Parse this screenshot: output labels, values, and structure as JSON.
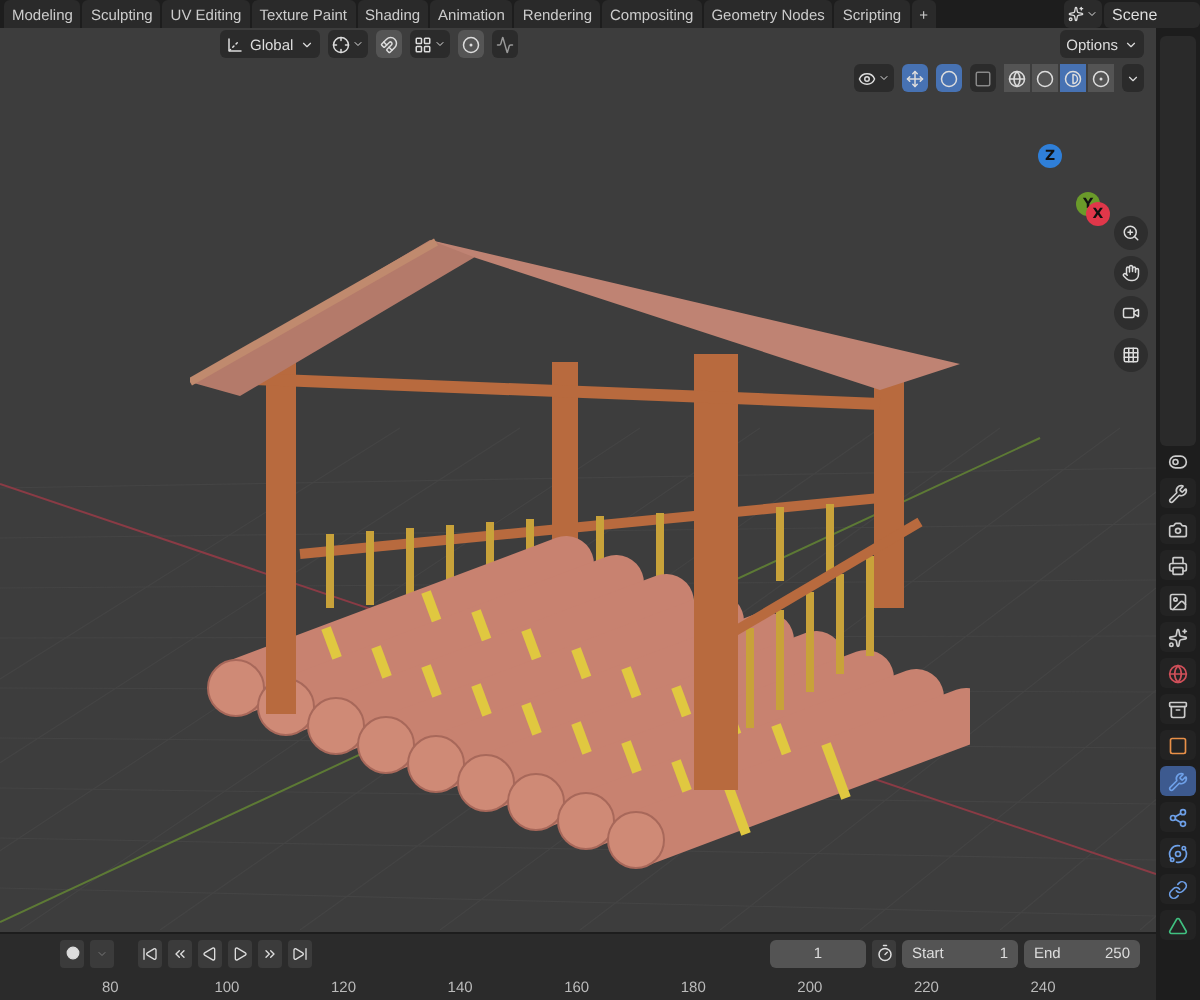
{
  "workspace_tabs": [
    {
      "label": "Modeling"
    },
    {
      "label": "Sculpting"
    },
    {
      "label": "UV Editing"
    },
    {
      "label": "Texture Paint"
    },
    {
      "label": "Shading"
    },
    {
      "label": "Animation"
    },
    {
      "label": "Rendering"
    },
    {
      "label": "Compositing"
    },
    {
      "label": "Geometry Nodes"
    },
    {
      "label": "Scripting"
    }
  ],
  "add_tab": "+",
  "scene": {
    "label": "Scene"
  },
  "header": {
    "orientation": "Global",
    "options": "Options",
    "proportional_editing": false,
    "snapping": false
  },
  "viewport_toggles": {
    "gizmos": true,
    "overlays": true,
    "xray": false
  },
  "shading_modes": [
    {
      "kind": "wireframe",
      "selected": false
    },
    {
      "kind": "solid",
      "selected": false
    },
    {
      "kind": "material",
      "selected": true
    },
    {
      "kind": "rendered",
      "selected": false
    }
  ],
  "gizmo_axes": [
    {
      "label": "Z",
      "color": "#2f7fd8"
    },
    {
      "label": "Y",
      "color": "#6a9a2a"
    },
    {
      "label": "X",
      "color": "#e0374a"
    }
  ],
  "property_tabs": [
    {
      "kind": "tool",
      "selected": false
    },
    {
      "kind": "render",
      "selected": false
    },
    {
      "kind": "output",
      "selected": false
    },
    {
      "kind": "view_layer",
      "selected": false
    },
    {
      "kind": "scene",
      "selected": false
    },
    {
      "kind": "world",
      "selected": false
    },
    {
      "kind": "collection",
      "selected": false
    },
    {
      "kind": "object",
      "selected": false
    },
    {
      "kind": "modifiers",
      "selected": true
    },
    {
      "kind": "particles",
      "selected": false
    },
    {
      "kind": "physics",
      "selected": false
    },
    {
      "kind": "constraints",
      "selected": false
    },
    {
      "kind": "data",
      "selected": false
    }
  ],
  "timeline": {
    "current_frame": "1",
    "start_label": "Start",
    "start": "1",
    "end_label": "End",
    "end": "250",
    "ruler": [
      "80",
      "100",
      "120",
      "140",
      "160",
      "180",
      "200",
      "220",
      "240"
    ]
  }
}
